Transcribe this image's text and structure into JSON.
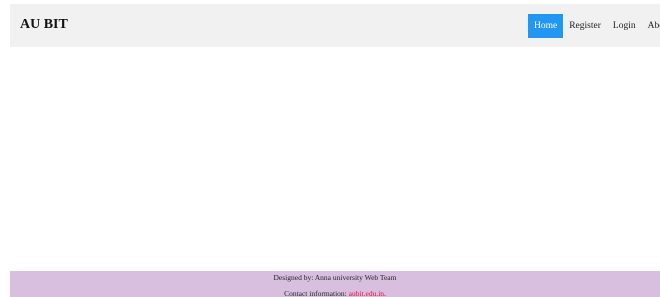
{
  "header": {
    "brand": "AU BIT",
    "nav": [
      {
        "label": "Home",
        "active": true
      },
      {
        "label": "Register",
        "active": false
      },
      {
        "label": "Login",
        "active": false
      },
      {
        "label": "About",
        "active": false
      }
    ]
  },
  "footer": {
    "designed_by": "Designed by: Anna university Web Team",
    "contact_prefix": "Contact information: ",
    "contact_link": "aubit.edu.in",
    "contact_suffix": "."
  },
  "colors": {
    "active_nav": "#2196F3",
    "nav_bg": "#f1f1f1",
    "footer_bg": "#d8bfe0",
    "link": "#e8102a"
  }
}
